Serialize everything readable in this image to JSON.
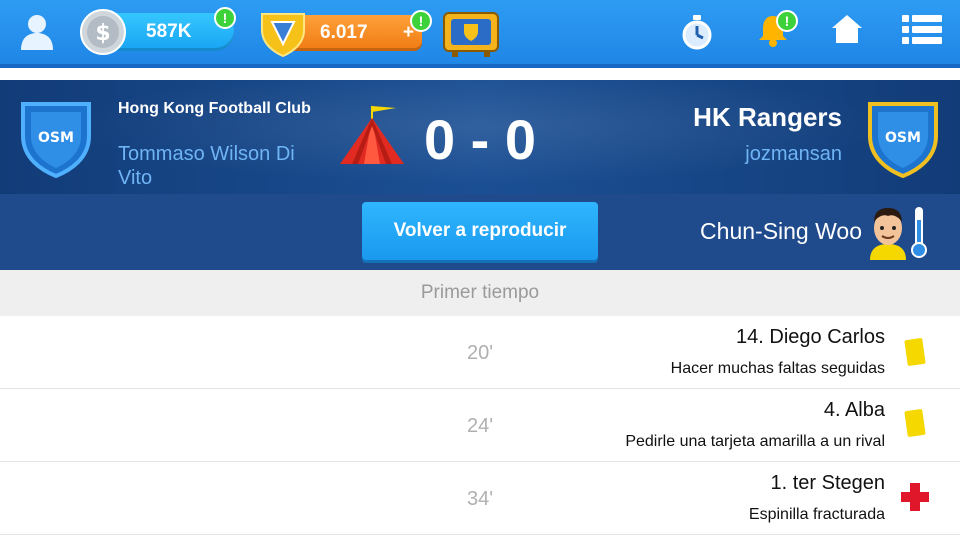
{
  "topbar": {
    "coins": "587K",
    "gold": "6.017",
    "gold_plus": "+",
    "coin_badge": "!",
    "gold_badge": "!",
    "bell_badge": "!",
    "icons": [
      "profile-icon",
      "silver-coin-icon",
      "gold-shield-icon",
      "tv-ad-icon",
      "stopwatch-icon",
      "bell-icon",
      "home-icon",
      "menu-icon"
    ]
  },
  "match": {
    "home_club": "Hong Kong Football Club",
    "home_manager": "Tommaso Wilson Di Vito",
    "score": "0 - 0",
    "away_club": "HK Rangers",
    "away_manager": "jozmansan",
    "crest_text": "OSM"
  },
  "controls": {
    "replay_label": "Volver a reproducir",
    "player_name": "Chun-Sing Woo"
  },
  "period": "Primer tiempo",
  "events": [
    {
      "minute": "20'",
      "player": "14. Diego Carlos",
      "description": "Hacer muchas faltas seguidas",
      "icon": "yellow-card-icon"
    },
    {
      "minute": "24'",
      "player": "4. Alba",
      "description": "Pedirle una tarjeta amarilla a un rival",
      "icon": "yellow-card-icon"
    },
    {
      "minute": "34'",
      "player": "1. ter Stegen",
      "description": "Espinilla fracturada",
      "icon": "injury-cross-icon"
    }
  ],
  "colors": {
    "topbar": "#1f86e6",
    "header": "#1b4f94",
    "accent": "#2fb6ff",
    "yellow_card": "#f5d800",
    "injury": "#e0162b"
  }
}
